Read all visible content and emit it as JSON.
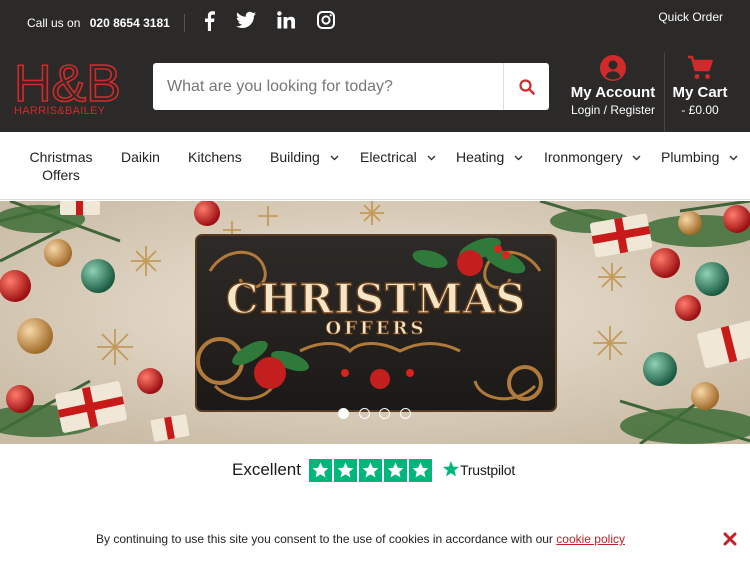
{
  "topbar": {
    "call_label": "Call us on",
    "phone": "020 8654 3181",
    "quick_order": "Quick Order",
    "social": [
      "facebook-icon",
      "twitter-icon",
      "linkedin-icon",
      "instagram-icon"
    ]
  },
  "brand": {
    "logo_text": "H&B",
    "tagline": "HARRIS&BAILEY",
    "color": "#d12a2a"
  },
  "search": {
    "placeholder": "What are you looking for today?",
    "icon": "search-icon"
  },
  "account": {
    "title": "My Account",
    "subtitle": "Login / Register"
  },
  "cart": {
    "title": "My Cart",
    "subtitle": "- £0.00"
  },
  "nav": {
    "items": [
      {
        "label": "Christmas Offers",
        "has_dropdown": false
      },
      {
        "label": "Daikin",
        "has_dropdown": false
      },
      {
        "label": "Kitchens",
        "has_dropdown": false
      },
      {
        "label": "Building",
        "has_dropdown": true
      },
      {
        "label": "Electrical",
        "has_dropdown": true
      },
      {
        "label": "Heating",
        "has_dropdown": true
      },
      {
        "label": "Ironmongery",
        "has_dropdown": true
      },
      {
        "label": "Plumbing",
        "has_dropdown": true
      }
    ]
  },
  "banner": {
    "line1": "CHRISTMAS",
    "line2": "OFFERS",
    "slide_count": 4,
    "active_slide": 1
  },
  "trustpilot": {
    "rating_label": "Excellent",
    "stars": 5,
    "brand": "Trustpilot",
    "color": "#00b67a"
  },
  "cookie": {
    "text": "By continuing to use this site you consent to the use of cookies in accordance with our",
    "link": "cookie policy"
  },
  "colors": {
    "header_bg": "#2b2a29",
    "accent": "#d12a2a"
  }
}
